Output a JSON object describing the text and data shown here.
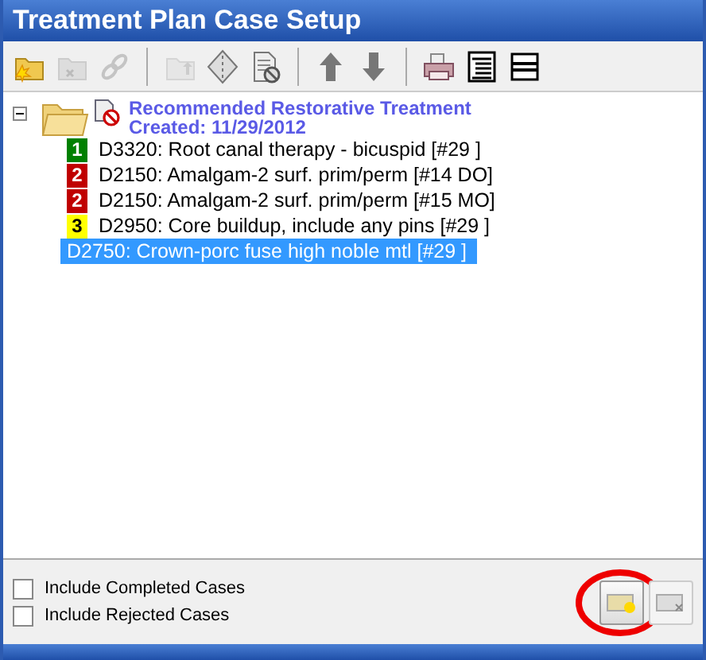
{
  "window": {
    "title": "Treatment Plan Case Setup"
  },
  "toolbar": [
    {
      "kind": "new-folder",
      "disabled": false
    },
    {
      "kind": "delete-folder",
      "disabled": true
    },
    {
      "kind": "link",
      "disabled": true
    },
    {
      "kind": "sep"
    },
    {
      "kind": "folder-up",
      "disabled": true
    },
    {
      "kind": "diamond",
      "disabled": false
    },
    {
      "kind": "doc-block",
      "disabled": false
    },
    {
      "kind": "sep"
    },
    {
      "kind": "up",
      "disabled": false
    },
    {
      "kind": "down",
      "disabled": false
    },
    {
      "kind": "sep"
    },
    {
      "kind": "printer",
      "disabled": false
    },
    {
      "kind": "list",
      "disabled": false
    },
    {
      "kind": "lines",
      "disabled": false
    }
  ],
  "tree": {
    "expanded": true,
    "title": "Recommended Restorative Treatment",
    "subtitle": "Created: 11/29/2012",
    "children": [
      {
        "priority": "1",
        "color": "#008000",
        "label": "D3320: Root canal therapy - bicuspid [#29 ]",
        "selected": false
      },
      {
        "priority": "2",
        "color": "#c00000",
        "label": "D2150: Amalgam-2 surf. prim/perm [#14 DO]",
        "selected": false
      },
      {
        "priority": "2",
        "color": "#c00000",
        "label": "D2150: Amalgam-2 surf. prim/perm [#15 MO]",
        "selected": false
      },
      {
        "priority": "3",
        "color": "#ffff00",
        "label": "D2950: Core buildup, include any pins [#29 ]",
        "selected": false
      },
      {
        "label": "D2750: Crown-porc fuse high noble mtl [#29 ]",
        "selected": true
      }
    ]
  },
  "options": [
    {
      "label": "Include Completed Cases",
      "checked": false
    },
    {
      "label": "Include Rejected Cases",
      "checked": false
    }
  ],
  "buttons": [
    {
      "kind": "add",
      "disabled": false,
      "highlighted": true
    },
    {
      "kind": "remove",
      "disabled": true
    }
  ]
}
